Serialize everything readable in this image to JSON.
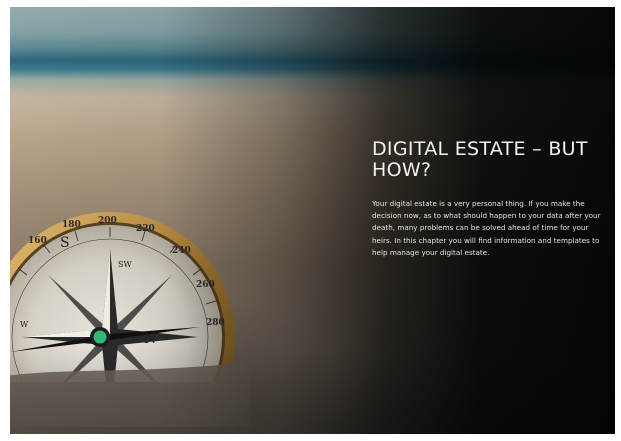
{
  "hero": {
    "title": "DIGITAL ESTATE – BUT HOW?",
    "body": "Your digital estate is a very personal thing. If you make the decision now, as to what should happen to your data after your death, many problems can be solved ahead of time for your heirs. In this chapter you will find information and templates to help manage your digital estate."
  },
  "compass": {
    "icon": "compass-icon",
    "dial_numbers": [
      "160",
      "180",
      "200",
      "220",
      "240",
      "260",
      "280"
    ],
    "cardinal_letters": [
      "S",
      "N",
      "SW",
      "W"
    ]
  },
  "colors": {
    "title": "#f2f2f2",
    "body": "#e6e6e6",
    "brass": "#b8893a",
    "needle_green": "#2fbf7a"
  }
}
